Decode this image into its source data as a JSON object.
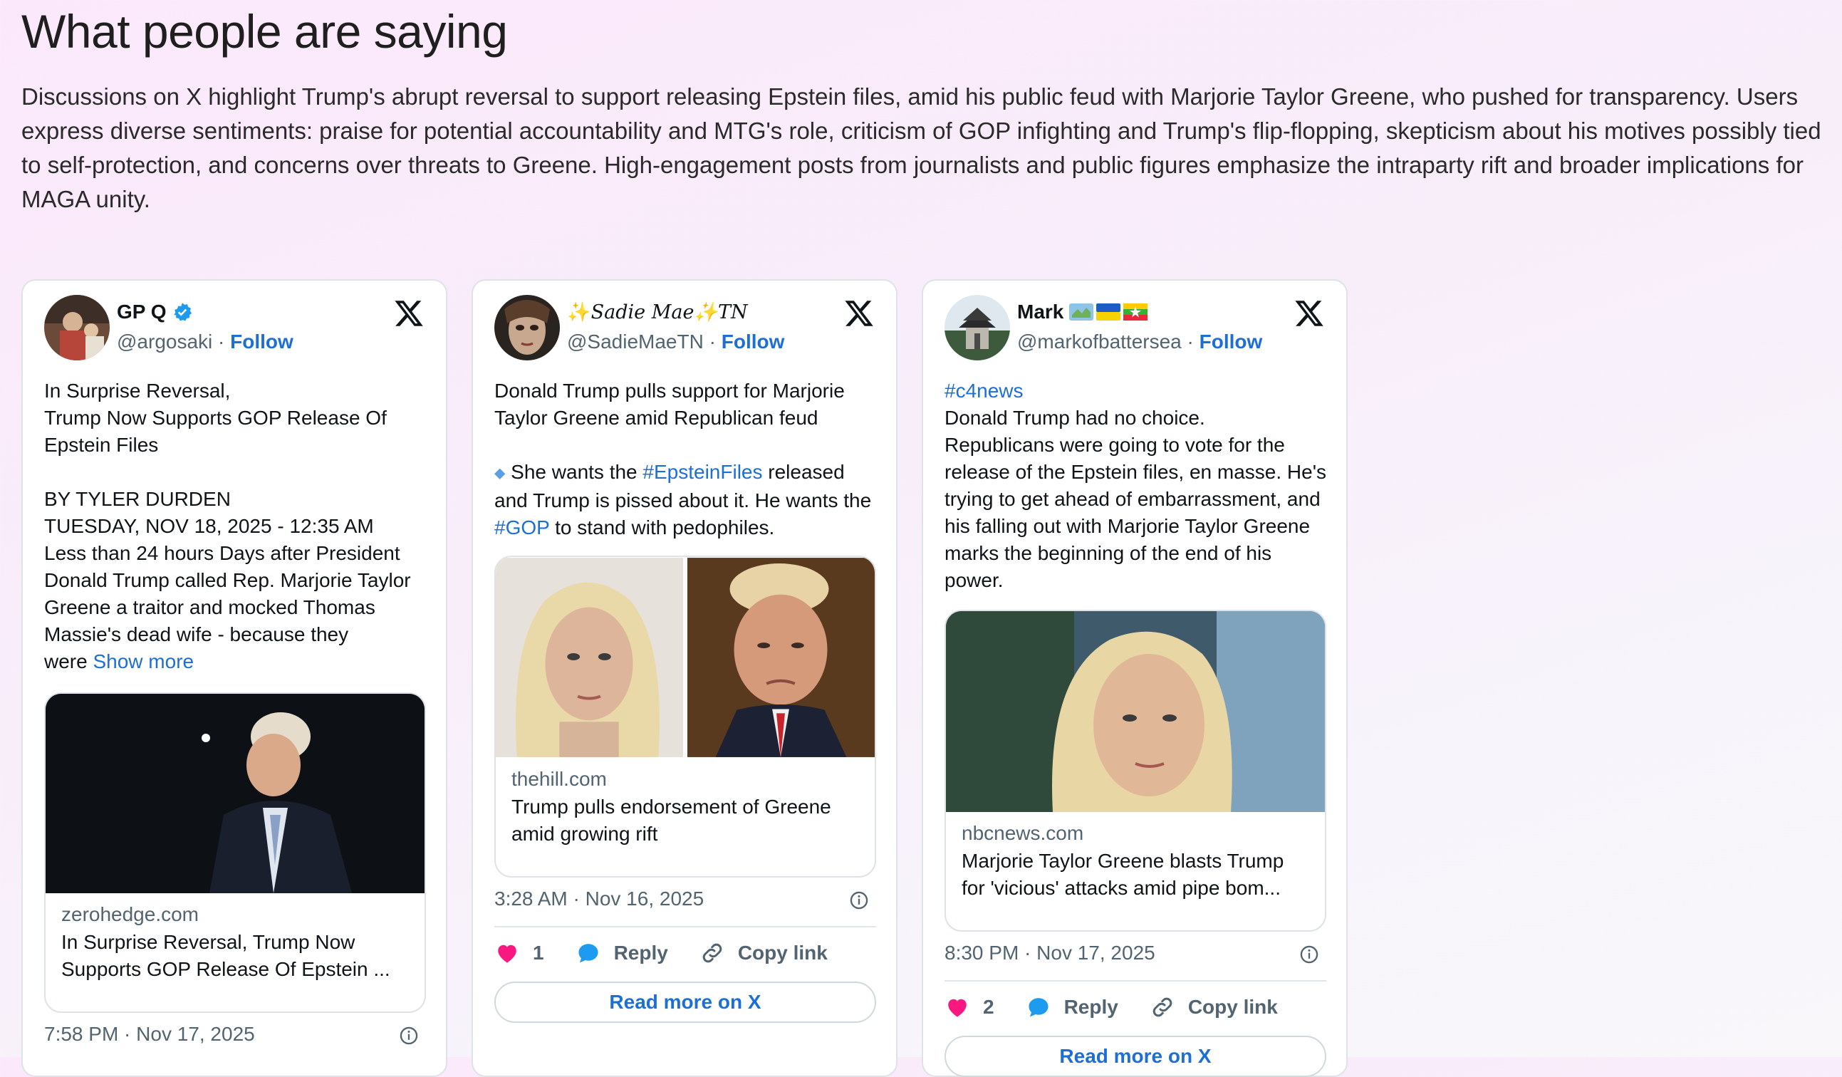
{
  "section": {
    "heading": "What people are saying",
    "summary": "Discussions on X highlight Trump's abrupt reversal to support releasing Epstein files, amid his public feud with Marjorie Taylor Greene, who pushed for transparency. Users express diverse sentiments: praise for potential accountability and MTG's role, criticism of GOP infighting and Trump's flip-flopping, skepticism about his motives possibly tied to self-protection, and concerns over threats to Greene. High-engagement posts from journalists and public figures emphasize the intraparty rift and broader implications for MAGA unity."
  },
  "posts": [
    {
      "name": "GP Q",
      "handle": "@argosaki",
      "follow": "Follow",
      "body": {
        "p1": "In Surprise Reversal,",
        "p2": "Trump Now Supports GOP Release Of",
        "p3": "Epstein Files",
        "p4": "BY TYLER DURDEN",
        "p5": "TUESDAY, NOV 18, 2025 - 12:35 AM",
        "p6": "Less than 24 hours Days after President Donald Trump called Rep. Marjorie Taylor Greene a traitor and mocked Thomas Massie's dead wife - because they",
        "p7": "were",
        "show_more": "Show more"
      },
      "link_card": {
        "domain": "zerohedge.com",
        "title": "In Surprise Reversal, Trump Now Supports GOP Release Of Epstein ..."
      },
      "timestamp": "7:58 PM · Nov 17, 2025"
    },
    {
      "name_pre": "✨",
      "name_main": "Sadie Mae",
      "name_post": "✨TN",
      "handle": "@SadieMaeTN",
      "follow": "Follow",
      "body": {
        "p1": "Donald Trump pulls support for Marjorie Taylor Greene amid Republican feud",
        "diamond": "◆",
        "p2a": " She wants the ",
        "tag1": "#EpsteinFiles",
        "p2b": " released and Trump is pissed about it. He wants the ",
        "tag2": "#GOP",
        "p2c": " to stand with pedophiles."
      },
      "link_card": {
        "domain": "thehill.com",
        "title": "Trump pulls endorsement of Greene amid growing rift"
      },
      "timestamp": "3:28 AM · Nov 16, 2025",
      "likes": "1",
      "reply_label": "Reply",
      "copy_label": "Copy link",
      "read_more": "Read more on X"
    },
    {
      "name": "Mark",
      "handle": "@markofbattersea",
      "follow": "Follow",
      "body": {
        "hashtag": "#c4news",
        "p1": "Donald Trump had no choice.",
        "p2": "Republicans were going to vote for the release of the Epstein files, en masse. He's trying to get ahead of embarrassment, and his falling out with Marjorie Taylor Greene marks the beginning of the end of his power."
      },
      "link_card": {
        "domain": "nbcnews.com",
        "title": "Marjorie Taylor Greene blasts Trump for 'vicious' attacks amid pipe bom..."
      },
      "timestamp": "8:30 PM · Nov 17, 2025",
      "likes": "2",
      "reply_label": "Reply",
      "copy_label": "Copy link",
      "read_more": "Read more on X"
    }
  ],
  "colors": {
    "accent": "#1d6fd6",
    "like": "#f91880",
    "reply": "#1d9bf0",
    "verified": "#1d9bf0"
  },
  "icons": [
    "x-logo-icon",
    "verified-badge-icon",
    "info-icon",
    "heart-icon",
    "reply-bubble-icon",
    "link-icon",
    "flag-icons"
  ]
}
